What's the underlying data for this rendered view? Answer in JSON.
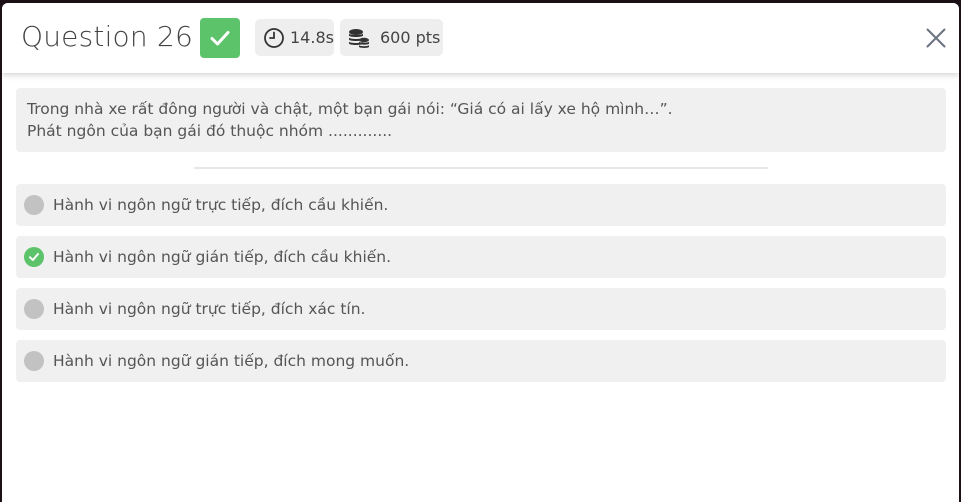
{
  "header": {
    "title": "Question 26",
    "status_icon": "check-icon",
    "status_color": "#5cc36b",
    "timer": {
      "icon": "clock-icon",
      "value": "14.8s"
    },
    "points": {
      "icon": "coins-icon",
      "value": "600 pts"
    },
    "close_icon": "close-icon"
  },
  "question": {
    "line1": "Trong nhà xe rất đông người và chật, một bạn gái nói: “Giá có ai lấy xe hộ mình…”.",
    "line2": "Phát ngôn của bạn gái đó thuộc nhóm ............."
  },
  "options": [
    {
      "label": "Hành vi ngôn ngữ trực tiếp, đích cầu khiến.",
      "state": "unselected"
    },
    {
      "label": "Hành vi ngôn ngữ gián tiếp, đích cầu khiến.",
      "state": "correct"
    },
    {
      "label": "Hành vi ngôn ngữ trực tiếp, đích xác tín.",
      "state": "unselected"
    },
    {
      "label": "Hành vi ngôn ngữ gián tiếp, đích mong muốn.",
      "state": "unselected"
    }
  ]
}
